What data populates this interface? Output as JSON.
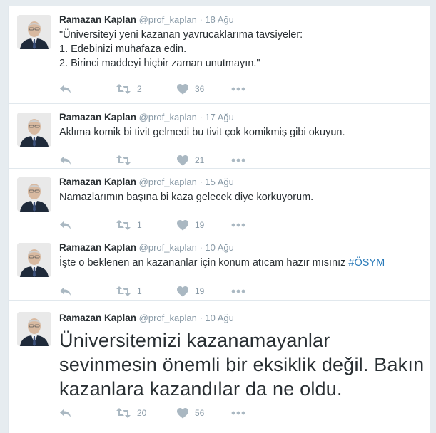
{
  "tweets": [
    {
      "fullname": "Ramazan Kaplan",
      "username": "@prof_kaplan",
      "separator": "·",
      "time": "18 Ağu",
      "lines": [
        "\"Üniversiteyi yeni kazanan yavrucaklarıma tavsiyeler:",
        "1. Edebinizi muhafaza edin.",
        "2. Birinci maddeyi hiçbir zaman unutmayın.\""
      ],
      "retweets": "2",
      "likes": "36"
    },
    {
      "fullname": "Ramazan Kaplan",
      "username": "@prof_kaplan",
      "separator": "·",
      "time": "17 Ağu",
      "lines": [
        "Aklıma komik bi tivit gelmedi bu tivit çok komikmiş gibi okuyun."
      ],
      "retweets": "",
      "likes": "21"
    },
    {
      "fullname": "Ramazan Kaplan",
      "username": "@prof_kaplan",
      "separator": "·",
      "time": "15 Ağu",
      "lines": [
        "Namazlarımın başına bi kaza gelecek diye korkuyorum."
      ],
      "retweets": "1",
      "likes": "19"
    },
    {
      "fullname": "Ramazan Kaplan",
      "username": "@prof_kaplan",
      "separator": "·",
      "time": "10 Ağu",
      "text": "İşte o beklenen an kazananlar için konum atıcam hazır mısınız",
      "hashtag": "#ÖSYM",
      "retweets": "1",
      "likes": "19"
    },
    {
      "fullname": "Ramazan Kaplan",
      "username": "@prof_kaplan",
      "separator": "·",
      "time": "10 Ağu",
      "lines": [
        "Üniversitemizi kazanamayanlar",
        "sevinmesin önemli bir eksiklik değil. Bakın",
        "kazanlara kazandılar da ne oldu."
      ],
      "retweets": "20",
      "likes": "56"
    }
  ],
  "icons": {
    "reply": "reply-icon",
    "retweet": "retweet-icon",
    "like": "heart-icon",
    "more": "more-icon"
  },
  "colors": {
    "background": "#e6ecf0",
    "text": "#292f33",
    "muted": "#8899a6",
    "icon": "#aab8c2",
    "hashtag": "#2b7bb9"
  }
}
